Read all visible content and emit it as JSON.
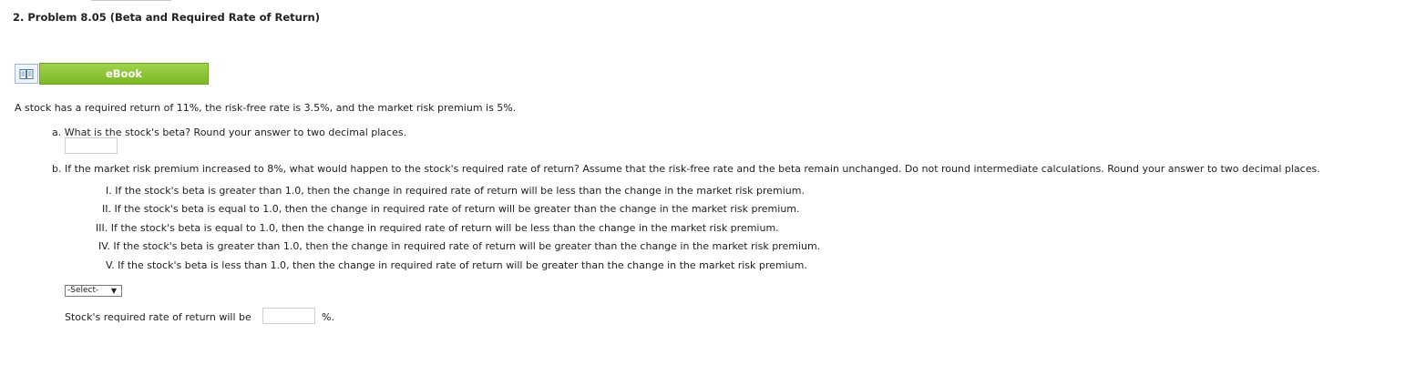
{
  "problem": {
    "title": "2.  Problem 8.05 (Beta and Required Rate of Return)"
  },
  "ebook": {
    "label": "eBook",
    "icon": "book-icon"
  },
  "statement": "A stock has a required return of 11%, the risk-free rate is 3.5%, and the market risk premium is 5%.",
  "part_a": {
    "question": "a. What is the stock's beta? Round your answer to two decimal places.",
    "answer_value": ""
  },
  "part_b": {
    "question": "b. If the market risk premium increased to 8%, what would happen to the stock's required rate of return? Assume that the risk-free rate and the beta remain unchanged. Do not round intermediate calculations. Round your answer to two decimal places.",
    "options": [
      "I. If the stock's beta is greater than 1.0, then the change in required rate of return will be less than the change in the market risk premium.",
      "II. If the stock's beta is equal to 1.0, then the change in required rate of return will be greater than the change in the market risk premium.",
      "III. If the stock's beta is equal to 1.0, then the change in required rate of return will be less than the change in the market risk premium.",
      "IV. If the stock's beta is greater than 1.0, then the change in required rate of return will be greater than the change in the market risk premium.",
      "V. If the stock's beta is less than 1.0, then the change in required rate of return will be greater than the change in the market risk premium."
    ],
    "select_value": "-Select-",
    "rate_label": "Stock's required rate of return will be",
    "rate_value": "",
    "rate_unit": "%."
  },
  "colors": {
    "ebook_green": "#8cc63f",
    "text": "#222222"
  }
}
